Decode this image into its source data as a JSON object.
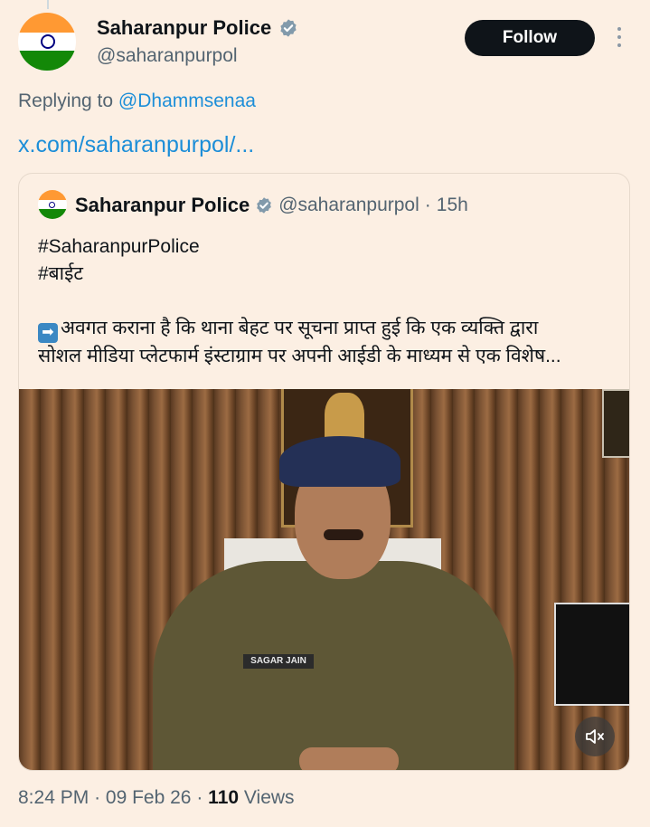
{
  "tweet": {
    "author_name": "Saharanpur Police",
    "author_handle": "@saharanpurpol",
    "follow_label": "Follow",
    "replying_prefix": "Replying to",
    "replying_to": "@Dhammsenaa",
    "link_text": "x.com/saharanpurpol/...",
    "time": "8:24 PM",
    "date": "09 Feb 26",
    "views_count": "110",
    "views_label": "Views",
    "separator": "·"
  },
  "quote": {
    "author_name": "Saharanpur Police",
    "author_handle": "@saharanpurpol",
    "time_ago": "15h",
    "hashtag1": "#SaharanpurPolice",
    "hashtag2": "#बाईट",
    "body_line1": "अवगत कराना है कि थाना बेहट पर सूचना प्राप्त हुई कि एक व्यक्ति द्वारा",
    "body_line2": "सोशल मीडिया प्लेटफार्म इंस्टाग्राम पर अपनी आईडी के माध्यम से एक विशेष...",
    "nameplate": "SAGAR JAIN"
  },
  "icons": {
    "verified": "verified-badge-icon",
    "more": "more-options-icon",
    "mute": "volume-mute-icon",
    "arrow_emoji": "right-arrow-emoji-icon"
  },
  "colors": {
    "background": "#fcefe3",
    "link": "#1c8ed8",
    "follow_bg": "#0f1419",
    "secondary_text": "#536471",
    "verified": "#829aab"
  }
}
